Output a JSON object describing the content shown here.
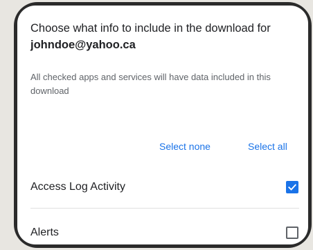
{
  "dialog": {
    "title": "Choose what info to include in the download for",
    "account_email": "johndoe@yahoo.ca",
    "description": "All checked apps and services will have data included in this download"
  },
  "actions": {
    "select_none": "Select none",
    "select_all": "Select all"
  },
  "services": [
    {
      "label": "Access Log Activity",
      "checked": true
    },
    {
      "label": "Alerts",
      "checked": false
    }
  ],
  "colors": {
    "accent": "#1a73e8",
    "text_primary": "#202124",
    "text_secondary": "#5f6368"
  }
}
